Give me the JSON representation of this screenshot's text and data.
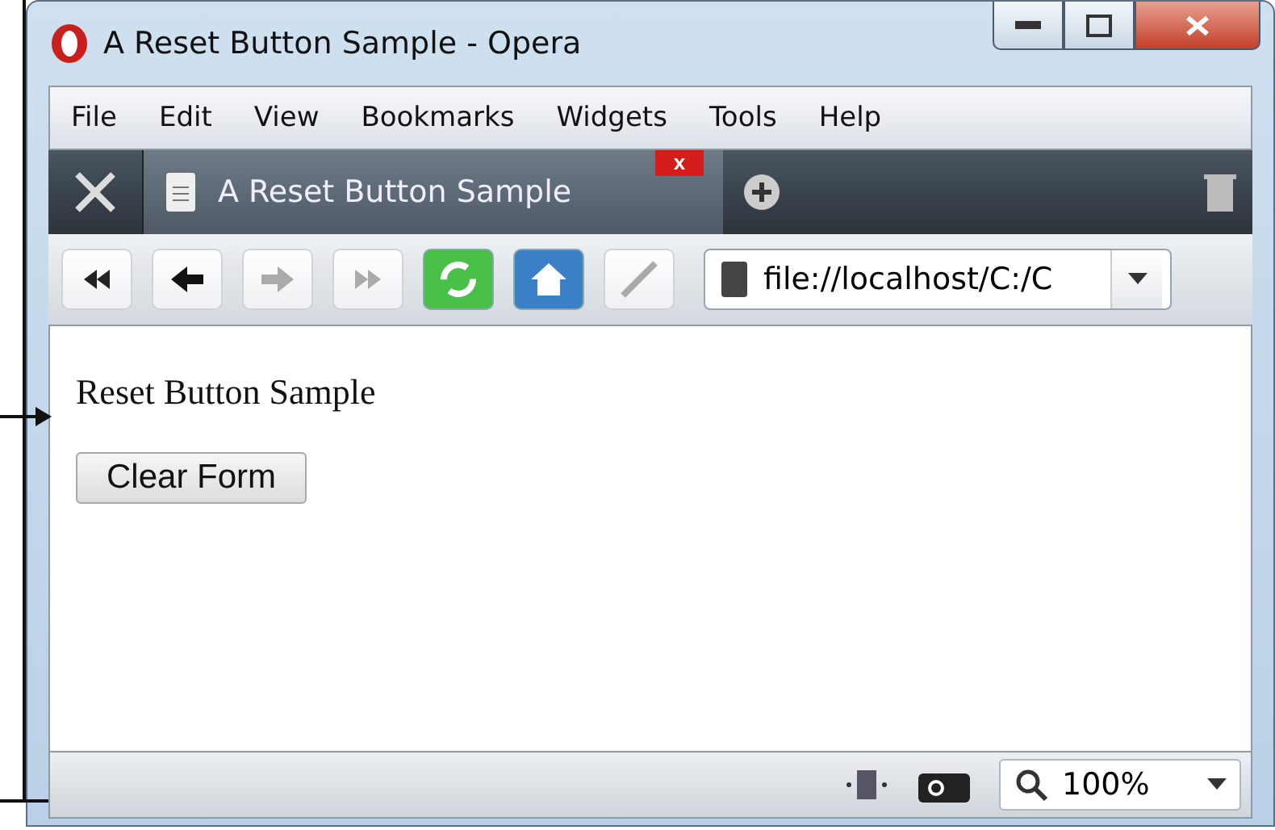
{
  "window": {
    "title": "A Reset Button Sample - Opera"
  },
  "menu": [
    "File",
    "Edit",
    "View",
    "Bookmarks",
    "Widgets",
    "Tools",
    "Help"
  ],
  "tabs": [
    {
      "label": "A Reset Button Sample",
      "selected": true,
      "close": "x"
    }
  ],
  "address": {
    "value": "file://localhost/C:/C"
  },
  "page": {
    "heading": "Reset Button Sample",
    "button": "Clear Form"
  },
  "status_bar": {
    "zoom": "100%"
  }
}
